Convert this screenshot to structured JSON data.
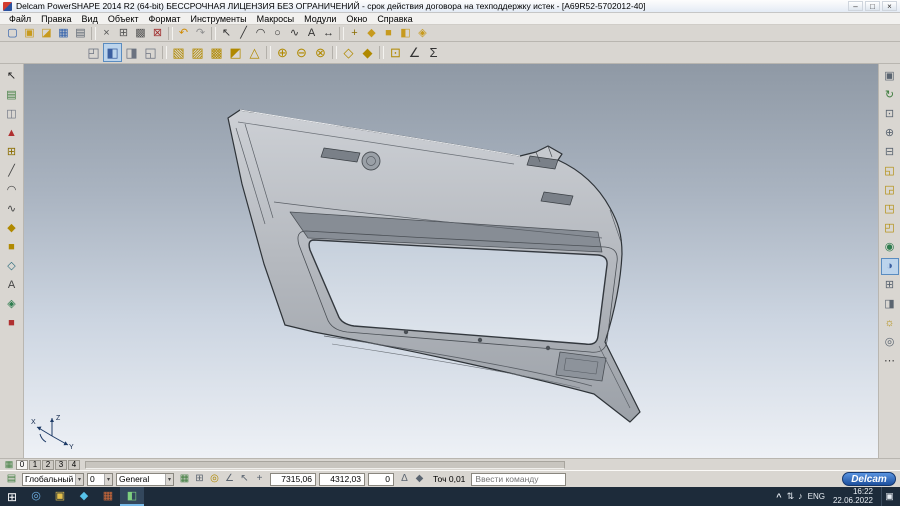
{
  "window": {
    "title": "Delcam PowerSHAPE 2014 R2 (64-bit) БЕССРОЧНАЯ ЛИЦЕНЗИЯ БЕЗ ОГРАНИЧЕНИЙ - срок действия договора на техподдержку истек - [A69R52-5702012-40]",
    "controls": {
      "minimize": "–",
      "maximize": "□",
      "close": "×"
    }
  },
  "ui": {
    "dropdown_arrow": "▾"
  },
  "menu": {
    "items": [
      "Файл",
      "Правка",
      "Вид",
      "Объект",
      "Формат",
      "Инструменты",
      "Макросы",
      "Модули",
      "Окно",
      "Справка"
    ]
  },
  "toolbar_main": {
    "icons": [
      {
        "n": "new-model-icon",
        "g": "▢",
        "c": "#2a5caa"
      },
      {
        "n": "open-model-icon",
        "g": "▣",
        "c": "#c79a1e"
      },
      {
        "n": "import-icon",
        "g": "◪",
        "c": "#c79a1e"
      },
      {
        "n": "save-icon",
        "g": "▦",
        "c": "#2a5caa"
      },
      {
        "n": "print-icon",
        "g": "▤",
        "c": "#5a6470"
      },
      {
        "n": "separator",
        "g": "",
        "c": ""
      },
      {
        "n": "cut-icon",
        "g": "×",
        "c": "#555555"
      },
      {
        "n": "copy-icon",
        "g": "⊞",
        "c": "#555555"
      },
      {
        "n": "paste-icon",
        "g": "▩",
        "c": "#555555"
      },
      {
        "n": "delete-icon",
        "g": "⊠",
        "c": "#a03030"
      },
      {
        "n": "separator",
        "g": "",
        "c": ""
      },
      {
        "n": "undo-icon",
        "g": "↶",
        "c": "#d08a00"
      },
      {
        "n": "redo-icon",
        "g": "↷",
        "c": "#909090"
      },
      {
        "n": "separator",
        "g": "",
        "c": ""
      },
      {
        "n": "select-arrow-icon",
        "g": "↖",
        "c": "#333333"
      },
      {
        "n": "line-icon",
        "g": "╱",
        "c": "#333333"
      },
      {
        "n": "arc-icon",
        "g": "◠",
        "c": "#333333"
      },
      {
        "n": "circle-icon",
        "g": "○",
        "c": "#333333"
      },
      {
        "n": "curve-icon",
        "g": "∿",
        "c": "#333333"
      },
      {
        "n": "text-icon",
        "g": "A",
        "c": "#333333"
      },
      {
        "n": "dimension-icon",
        "g": "↔",
        "c": "#333333"
      },
      {
        "n": "separator",
        "g": "",
        "c": ""
      },
      {
        "n": "workplane-icon",
        "g": "+",
        "c": "#8a6d00"
      },
      {
        "n": "surface-icon",
        "g": "◆",
        "c": "#c79a1e"
      },
      {
        "n": "solid-icon",
        "g": "■",
        "c": "#c79a1e"
      },
      {
        "n": "feature-icon",
        "g": "◧",
        "c": "#c79a1e"
      },
      {
        "n": "assembly-icon",
        "g": "◈",
        "c": "#c79a1e"
      }
    ]
  },
  "toolbar_secondary": {
    "icons": [
      {
        "n": "pick-filter-icon",
        "g": "◰",
        "c": "#6b7280"
      },
      {
        "n": "shaded-view-icon",
        "g": "◧",
        "c": "#3b5fa0",
        "active": true
      },
      {
        "n": "wireframe-view-icon",
        "g": "◨",
        "c": "#6b7280"
      },
      {
        "n": "dynamic-section-icon",
        "g": "◱",
        "c": "#6b7280"
      },
      {
        "n": "separator",
        "g": "",
        "c": ""
      },
      {
        "n": "solid-block-icon",
        "g": "▧",
        "c": "#b08900"
      },
      {
        "n": "solid-extrude-icon",
        "g": "▨",
        "c": "#b08900"
      },
      {
        "n": "solid-revolve-icon",
        "g": "▩",
        "c": "#b08900"
      },
      {
        "n": "solid-sweep-icon",
        "g": "◩",
        "c": "#b08900"
      },
      {
        "n": "solid-fillet-icon",
        "g": "△",
        "c": "#b08900"
      },
      {
        "n": "separator",
        "g": "",
        "c": ""
      },
      {
        "n": "boolean-union-icon",
        "g": "⊕",
        "c": "#b08900"
      },
      {
        "n": "boolean-subtract-icon",
        "g": "⊖",
        "c": "#b08900"
      },
      {
        "n": "boolean-intersect-icon",
        "g": "⊗",
        "c": "#b08900"
      },
      {
        "n": "separator",
        "g": "",
        "c": ""
      },
      {
        "n": "surface-network-icon",
        "g": "◇",
        "c": "#b08900"
      },
      {
        "n": "surface-extrude-icon",
        "g": "◆",
        "c": "#b08900"
      },
      {
        "n": "separator",
        "g": "",
        "c": ""
      },
      {
        "n": "feature-hole-icon",
        "g": "⊡",
        "c": "#b08900"
      },
      {
        "n": "measure-icon",
        "g": "∠",
        "c": "#333333"
      },
      {
        "n": "calculator-icon",
        "g": "Σ",
        "c": "#333333"
      }
    ]
  },
  "left_toolbar": {
    "icons": [
      {
        "n": "select-cursor-icon",
        "g": "↖",
        "c": "#222222"
      },
      {
        "n": "model-tree-icon",
        "g": "▤",
        "c": "#3f7d3f"
      },
      {
        "n": "clipboard-icon",
        "g": "◫",
        "c": "#6b7280"
      },
      {
        "n": "alert-icon",
        "g": "▲",
        "c": "#b03030"
      },
      {
        "n": "workplane-tool-icon",
        "g": "⊞",
        "c": "#8a6d00"
      },
      {
        "n": "line-tool-icon",
        "g": "╱",
        "c": "#444444"
      },
      {
        "n": "arc-tool-icon",
        "g": "◠",
        "c": "#444444"
      },
      {
        "n": "curve-tool-icon",
        "g": "∿",
        "c": "#444444"
      },
      {
        "n": "surface-tool-icon",
        "g": "◆",
        "c": "#b08900"
      },
      {
        "n": "solid-tool-icon",
        "g": "■",
        "c": "#b08900"
      },
      {
        "n": "wireframe-tool-icon",
        "g": "◇",
        "c": "#2f6d7d"
      },
      {
        "n": "annotation-tool-icon",
        "g": "A",
        "c": "#444444"
      },
      {
        "n": "symbol-tool-icon",
        "g": "◈",
        "c": "#2f7d4f"
      },
      {
        "n": "stop-icon",
        "g": "■",
        "c": "#b03030"
      }
    ]
  },
  "right_toolbar": {
    "icons": [
      {
        "n": "page-view-icon",
        "g": "▣",
        "c": "#5a6470"
      },
      {
        "n": "refresh-view-icon",
        "g": "↻",
        "c": "#3f7d3f"
      },
      {
        "n": "zoom-full-icon",
        "g": "⊡",
        "c": "#5a6470"
      },
      {
        "n": "zoom-in-icon",
        "g": "⊕",
        "c": "#5a6470"
      },
      {
        "n": "zoom-box-icon",
        "g": "⊟",
        "c": "#5a6470"
      },
      {
        "n": "view-top-icon",
        "g": "◱",
        "c": "#b08900"
      },
      {
        "n": "view-front-icon",
        "g": "◲",
        "c": "#b08900"
      },
      {
        "n": "view-side-icon",
        "g": "◳",
        "c": "#b08900"
      },
      {
        "n": "view-iso-icon",
        "g": "◰",
        "c": "#b08900"
      },
      {
        "n": "globe-icon",
        "g": "◉",
        "c": "#2f7d4f"
      },
      {
        "n": "shading-mode-icon",
        "g": "◑",
        "c": "#3b5fa0",
        "active": true
      },
      {
        "n": "multi-window-icon",
        "g": "⊞",
        "c": "#5a6470"
      },
      {
        "n": "section-view-icon",
        "g": "◨",
        "c": "#5a6470"
      },
      {
        "n": "light-icon",
        "g": "☼",
        "c": "#b08900"
      },
      {
        "n": "camera-icon",
        "g": "◎",
        "c": "#5a6470"
      },
      {
        "n": "more-tools-icon",
        "g": "⋯",
        "c": "#444444"
      }
    ]
  },
  "viewport": {
    "axis": {
      "x": "X",
      "y": "Y",
      "z": "Z"
    }
  },
  "levels_bar": {
    "icon": {
      "n": "levels-icon",
      "g": "▦"
    },
    "tabs": [
      {
        "label": "0",
        "active": true
      },
      {
        "label": "1"
      },
      {
        "label": "2"
      },
      {
        "label": "3"
      },
      {
        "label": "4"
      }
    ]
  },
  "status_bar": {
    "left_icons": [
      {
        "n": "workspace-icon",
        "g": "▤",
        "c": "#3f7d3f"
      }
    ],
    "workspace_select": {
      "value": "Глобальный"
    },
    "level_spinner": {
      "value": "0"
    },
    "style_select": {
      "value": "General"
    },
    "toggle_icons": [
      {
        "n": "levels-toggle-icon",
        "g": "▦",
        "c": "#3f7d3f"
      },
      {
        "n": "grid-toggle-icon",
        "g": "⊞",
        "c": "#5a6470"
      },
      {
        "n": "snap-toggle-icon",
        "g": "◎",
        "c": "#b08900"
      },
      {
        "n": "angle-snap-icon",
        "g": "∠",
        "c": "#5a6470"
      },
      {
        "n": "cursor-snap-icon",
        "g": "↖",
        "c": "#5a6470"
      },
      {
        "n": "position-icon",
        "g": "+",
        "c": "#5a6470"
      }
    ],
    "coords": {
      "x": "7315,06",
      "y": "4312,03",
      "z": "0"
    },
    "mid_icons": [
      {
        "n": "relative-coords-icon",
        "g": "Δ",
        "c": "#5a6470"
      },
      {
        "n": "lock-coords-icon",
        "g": "◆",
        "c": "#5a6470"
      }
    ],
    "tolerance_label": "Точ 0,01",
    "command_input": {
      "placeholder": "Ввести команду"
    },
    "logo": {
      "label": "Delcam"
    }
  },
  "taskbar": {
    "start": {
      "g": "⊞"
    },
    "apps": [
      {
        "n": "taskbar-app-browser",
        "g": "◎",
        "c": "#6fb3e8"
      },
      {
        "n": "taskbar-app-explorer",
        "g": "▣",
        "c": "#e3bf4a"
      },
      {
        "n": "taskbar-app-mail",
        "g": "◆",
        "c": "#57c2ea"
      },
      {
        "n": "taskbar-app-office",
        "g": "▦",
        "c": "#d06a3a"
      },
      {
        "n": "taskbar-app-powershape",
        "g": "◧",
        "c": "#7fd07f",
        "active": true
      }
    ],
    "tray": {
      "chevron": "^",
      "icons": [
        {
          "n": "network-icon",
          "g": "⇅"
        },
        {
          "n": "volume-icon",
          "g": "♪"
        }
      ],
      "lang": "ENG",
      "time": "16:22",
      "date": "22.06.2022",
      "action": "▣"
    }
  }
}
